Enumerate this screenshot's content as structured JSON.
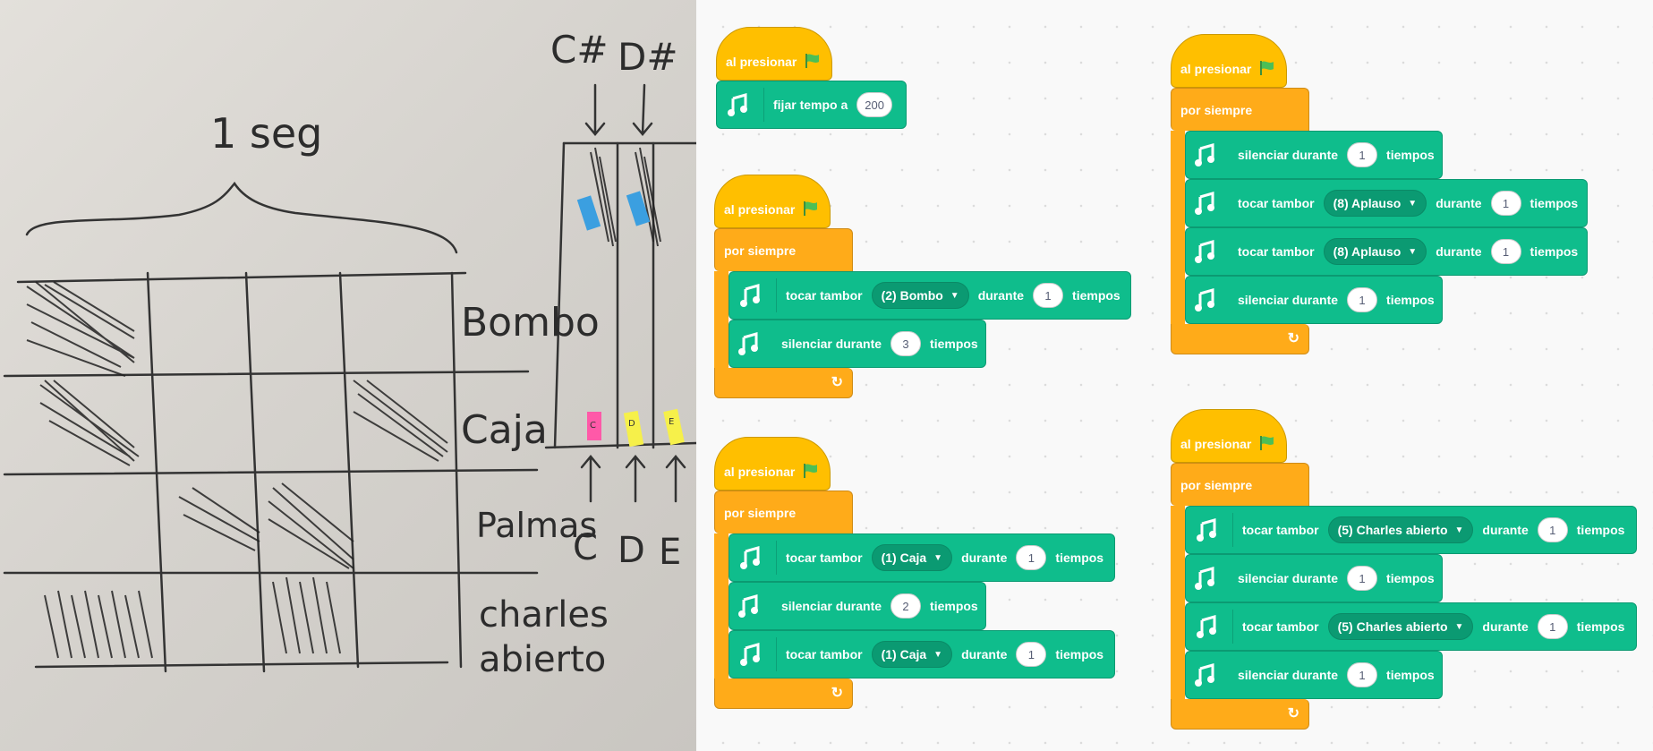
{
  "photo": {
    "annotations": [
      "1 seg",
      "Bombo",
      "Caja",
      "Palmas",
      "C",
      "D",
      "E",
      "charles",
      "abierto",
      "C#",
      "D#",
      "C",
      "D",
      "E"
    ]
  },
  "workspace": {
    "scripts": [
      {
        "hat": "al presionar",
        "blocks": [
          {
            "type": "tempo",
            "label": "fijar tempo a",
            "value": "200"
          }
        ]
      },
      {
        "hat": "al presionar",
        "loop": "por siempre",
        "blocks": [
          {
            "type": "drum",
            "label": "tocar tambor",
            "drum": "(2) Bombo",
            "mid": "durante",
            "beats": "1",
            "end": "tiempos"
          },
          {
            "type": "rest",
            "label": "silenciar durante",
            "beats": "3",
            "end": "tiempos"
          }
        ]
      },
      {
        "hat": "al presionar",
        "loop": "por siempre",
        "blocks": [
          {
            "type": "drum",
            "label": "tocar tambor",
            "drum": "(1) Caja",
            "mid": "durante",
            "beats": "1",
            "end": "tiempos"
          },
          {
            "type": "rest",
            "label": "silenciar durante",
            "beats": "2",
            "end": "tiempos"
          },
          {
            "type": "drum",
            "label": "tocar tambor",
            "drum": "(1) Caja",
            "mid": "durante",
            "beats": "1",
            "end": "tiempos"
          }
        ]
      },
      {
        "hat": "al presionar",
        "loop": "por siempre",
        "blocks": [
          {
            "type": "rest",
            "label": "silenciar durante",
            "beats": "1",
            "end": "tiempos"
          },
          {
            "type": "drum",
            "label": "tocar tambor",
            "drum": "(8) Aplauso",
            "mid": "durante",
            "beats": "1",
            "end": "tiempos"
          },
          {
            "type": "drum",
            "label": "tocar tambor",
            "drum": "(8) Aplauso",
            "mid": "durante",
            "beats": "1",
            "end": "tiempos"
          },
          {
            "type": "rest",
            "label": "silenciar durante",
            "beats": "1",
            "end": "tiempos"
          }
        ]
      },
      {
        "hat": "al presionar",
        "loop": "por siempre",
        "blocks": [
          {
            "type": "drum",
            "label": "tocar tambor",
            "drum": "(5) Charles abierto",
            "mid": "durante",
            "beats": "1",
            "end": "tiempos"
          },
          {
            "type": "rest",
            "label": "silenciar durante",
            "beats": "1",
            "end": "tiempos"
          },
          {
            "type": "drum",
            "label": "tocar tambor",
            "drum": "(5) Charles abierto",
            "mid": "durante",
            "beats": "1",
            "end": "tiempos"
          },
          {
            "type": "rest",
            "label": "silenciar durante",
            "beats": "1",
            "end": "tiempos"
          }
        ]
      }
    ]
  },
  "colors": {
    "events": "#ffbf00",
    "control": "#ffab19",
    "music": "#0fbd8c",
    "flag": "#4cbf56"
  }
}
